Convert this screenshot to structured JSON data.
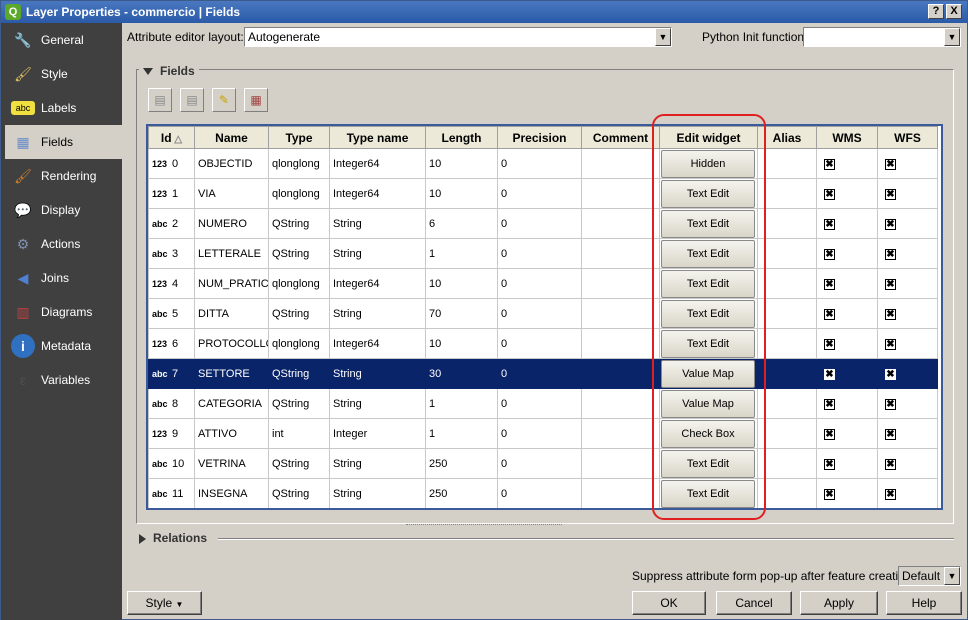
{
  "window": {
    "title": "Layer Properties - commercio | Fields",
    "help_label": "?",
    "close_label": "X"
  },
  "sidebar": {
    "items": [
      {
        "label": "General",
        "icon": "wrench-icon"
      },
      {
        "label": "Style",
        "icon": "paintbrush-icon"
      },
      {
        "label": "Labels",
        "icon": "abc-label-icon"
      },
      {
        "label": "Fields",
        "icon": "table-icon",
        "selected": true
      },
      {
        "label": "Rendering",
        "icon": "brush-icon"
      },
      {
        "label": "Display",
        "icon": "speech-bubble-icon"
      },
      {
        "label": "Actions",
        "icon": "gear-icon"
      },
      {
        "label": "Joins",
        "icon": "join-arrow-icon"
      },
      {
        "label": "Diagrams",
        "icon": "chart-icon"
      },
      {
        "label": "Metadata",
        "icon": "info-icon"
      },
      {
        "label": "Variables",
        "icon": "epsilon-icon"
      }
    ]
  },
  "top": {
    "editor_layout_label": "Attribute editor layout:",
    "editor_layout_value": "Autogenerate",
    "python_init_label": "Python Init function",
    "python_init_value": ""
  },
  "fields": {
    "title": "Fields",
    "columns": [
      "Id",
      "Name",
      "Type",
      "Type name",
      "Length",
      "Precision",
      "Comment",
      "Edit widget",
      "Alias",
      "WMS",
      "WFS"
    ],
    "rows": [
      {
        "icon": "123",
        "id": "0",
        "name": "OBJECTID",
        "type": "qlonglong",
        "type_name": "Integer64",
        "length": "10",
        "precision": "0",
        "comment": "",
        "widget": "Hidden",
        "alias": "",
        "wms": "✖",
        "wfs": "✖"
      },
      {
        "icon": "123",
        "id": "1",
        "name": "VIA",
        "type": "qlonglong",
        "type_name": "Integer64",
        "length": "10",
        "precision": "0",
        "comment": "",
        "widget": "Text Edit",
        "alias": "",
        "wms": "✖",
        "wfs": "✖"
      },
      {
        "icon": "abc",
        "id": "2",
        "name": "NUMERO",
        "type": "QString",
        "type_name": "String",
        "length": "6",
        "precision": "0",
        "comment": "",
        "widget": "Text Edit",
        "alias": "",
        "wms": "✖",
        "wfs": "✖"
      },
      {
        "icon": "abc",
        "id": "3",
        "name": "LETTERALE",
        "type": "QString",
        "type_name": "String",
        "length": "1",
        "precision": "0",
        "comment": "",
        "widget": "Text Edit",
        "alias": "",
        "wms": "✖",
        "wfs": "✖"
      },
      {
        "icon": "123",
        "id": "4",
        "name": "NUM_PRATIC",
        "type": "qlonglong",
        "type_name": "Integer64",
        "length": "10",
        "precision": "0",
        "comment": "",
        "widget": "Text Edit",
        "alias": "",
        "wms": "✖",
        "wfs": "✖"
      },
      {
        "icon": "abc",
        "id": "5",
        "name": "DITTA",
        "type": "QString",
        "type_name": "String",
        "length": "70",
        "precision": "0",
        "comment": "",
        "widget": "Text Edit",
        "alias": "",
        "wms": "✖",
        "wfs": "✖"
      },
      {
        "icon": "123",
        "id": "6",
        "name": "PROTOCOLLO",
        "type": "qlonglong",
        "type_name": "Integer64",
        "length": "10",
        "precision": "0",
        "comment": "",
        "widget": "Text Edit",
        "alias": "",
        "wms": "✖",
        "wfs": "✖"
      },
      {
        "icon": "abc",
        "id": "7",
        "name": "SETTORE",
        "type": "QString",
        "type_name": "String",
        "length": "30",
        "precision": "0",
        "comment": "",
        "widget": "Value Map",
        "alias": "",
        "wms": "✖",
        "wfs": "✖",
        "selected": true
      },
      {
        "icon": "abc",
        "id": "8",
        "name": "CATEGORIA",
        "type": "QString",
        "type_name": "String",
        "length": "1",
        "precision": "0",
        "comment": "",
        "widget": "Value Map",
        "alias": "",
        "wms": "✖",
        "wfs": "✖"
      },
      {
        "icon": "123",
        "id": "9",
        "name": "ATTIVO",
        "type": "int",
        "type_name": "Integer",
        "length": "1",
        "precision": "0",
        "comment": "",
        "widget": "Check Box",
        "alias": "",
        "wms": "✖",
        "wfs": "✖"
      },
      {
        "icon": "abc",
        "id": "10",
        "name": "VETRINA",
        "type": "QString",
        "type_name": "String",
        "length": "250",
        "precision": "0",
        "comment": "",
        "widget": "Text Edit",
        "alias": "",
        "wms": "✖",
        "wfs": "✖"
      },
      {
        "icon": "abc",
        "id": "11",
        "name": "INSEGNA",
        "type": "QString",
        "type_name": "String",
        "length": "250",
        "precision": "0",
        "comment": "",
        "widget": "Text Edit",
        "alias": "",
        "wms": "✖",
        "wfs": "✖"
      }
    ]
  },
  "relations": {
    "title": "Relations"
  },
  "bottom": {
    "suppress_label": "Suppress attribute form pop-up after feature creation",
    "suppress_value": "Default",
    "style_label": "Style",
    "ok_label": "OK",
    "cancel_label": "Cancel",
    "apply_label": "Apply",
    "help_label": "Help"
  },
  "colors": {
    "selection": "#0a246a",
    "sidebar_bg": "#404040",
    "highlight_box": "#e02020"
  }
}
